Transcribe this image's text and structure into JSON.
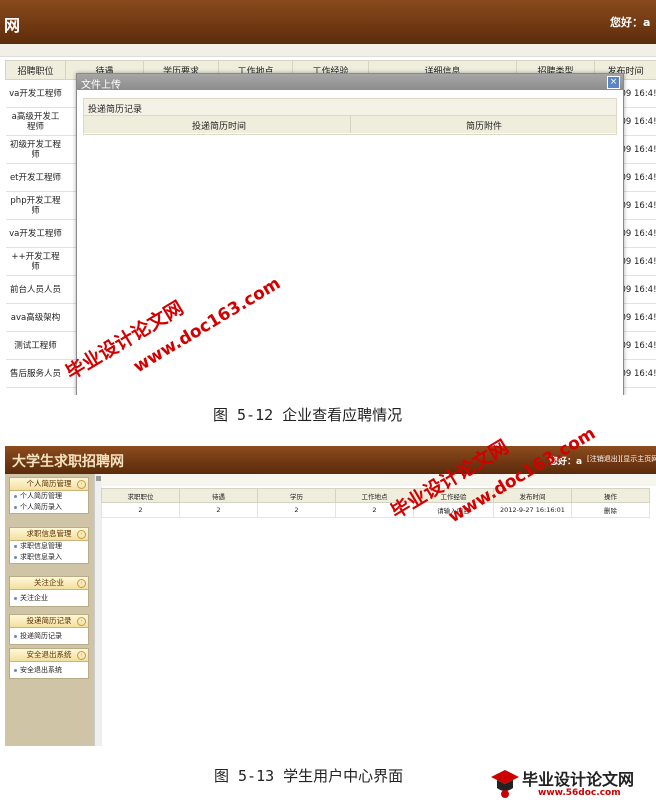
{
  "screen1": {
    "logo": "网",
    "greeting": "您好：a",
    "columns": [
      "招聘职位",
      "待遇",
      "学历要求",
      "工作地点",
      "工作经验",
      "详细信息",
      "招聘类型",
      "发布时间"
    ],
    "rows": [
      {
        "job": "va开发工程师",
        "time": ".09 16:4!"
      },
      {
        "job": "a高级开发工程师",
        "time": ".09 16:4!"
      },
      {
        "job": "初级开发工程师",
        "time": ".09 16:4!"
      },
      {
        "job": "et开发工程师",
        "time": ".09 16:4!"
      },
      {
        "job": "php开发工程师",
        "time": ".09 16:4!"
      },
      {
        "job": "va开发工程师",
        "time": ".09 16:4!"
      },
      {
        "job": "++开发工程师",
        "time": ".09 16:4!"
      },
      {
        "job": "前台人员人员",
        "time": ".09 16:4!"
      },
      {
        "job": "ava高级架构",
        "time": ".09 16:4!"
      },
      {
        "job": "测试工程师",
        "time": ".09 16:4!"
      },
      {
        "job": "售后服务人员",
        "time": ".09 16:4!"
      }
    ],
    "modal": {
      "title": "文件上传",
      "close": "×",
      "panel_title": "投递简历记录",
      "col_time": "投递简历时间",
      "col_attach": "简历附件"
    }
  },
  "caption1": "图 5-12 企业查看应聘情况",
  "screen2": {
    "logo": "大学生求职招聘网",
    "greeting": "您好：a",
    "links": "[注销退出][显示主页网",
    "sidebar": [
      {
        "title": "个人简历管理",
        "items": [
          "个人简历管理",
          "个人简历录入"
        ]
      },
      {
        "title": "求职信息管理",
        "items": [
          "求职信息管理",
          "求职信息录入"
        ]
      },
      {
        "title": "关注企业",
        "items": [
          "关注企业"
        ]
      },
      {
        "title": "投递简历记录",
        "items": [
          "投递简历记录"
        ]
      },
      {
        "title": "安全退出系统",
        "items": [
          "安全退出系统"
        ]
      }
    ],
    "columns": [
      "求职职位",
      "待遇",
      "学历",
      "工作地点",
      "工作经验",
      "发布时间",
      "操作"
    ],
    "row": [
      "2",
      "2",
      "2",
      "2",
      "请输入内容",
      "2012-9-27 16:16:01",
      "删除"
    ]
  },
  "caption2": "图 5-13 学生用户中心界面",
  "watermarks": {
    "brand": "毕业设计论文网",
    "url": "www.doc163.com"
  },
  "footer_logo": {
    "text": "毕业设计论文网",
    "url": "www.56doc.com"
  },
  "colors": {
    "header": "#6f3812",
    "accent_red": "#d40000"
  }
}
